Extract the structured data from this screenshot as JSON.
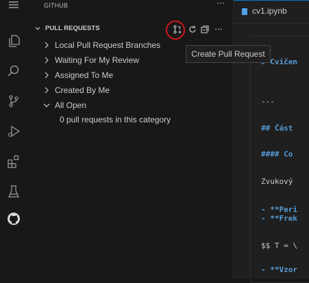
{
  "colors": {
    "accent": "#0078d4",
    "highlight_ring": "#d0161b",
    "md_heading": "#569cd6",
    "md_bold": "#569cd6"
  },
  "activity_bar": {
    "items": [
      {
        "icon": "menu-icon"
      },
      {
        "icon": "explorer-icon"
      },
      {
        "icon": "search-icon"
      },
      {
        "icon": "source-control-icon"
      },
      {
        "icon": "run-debug-icon"
      },
      {
        "icon": "extensions-icon"
      },
      {
        "icon": "testing-icon"
      },
      {
        "icon": "github-icon"
      }
    ]
  },
  "sidebar": {
    "title": "GITHUB",
    "more": "···",
    "pane": {
      "title": "PULL REQUESTS",
      "actions": [
        {
          "icon": "create-pull-request-icon"
        },
        {
          "icon": "refresh-icon"
        },
        {
          "icon": "collapse-all-icon"
        },
        {
          "icon": "more-icon",
          "label": "···"
        }
      ]
    },
    "tree": [
      {
        "label": "Local Pull Request Branches",
        "expanded": false
      },
      {
        "label": "Waiting For My Review",
        "expanded": false
      },
      {
        "label": "Assigned To Me",
        "expanded": false
      },
      {
        "label": "Created By Me",
        "expanded": false
      },
      {
        "label": "All Open",
        "expanded": true
      }
    ],
    "empty_message": "0 pull requests in this category"
  },
  "tooltip": {
    "text": "Create Pull Request"
  },
  "editor": {
    "tab_label": "cv1.ipynb",
    "lines": [
      {
        "text": "# Cvičen",
        "style": "heading"
      },
      {
        "text": "---",
        "style": "plain"
      },
      {
        "text": "## Část",
        "style": "heading"
      },
      {
        "text": "#### Co",
        "style": "heading"
      },
      {
        "text": "Zvukový",
        "style": "plain"
      },
      {
        "text": "- **Peri",
        "style": "bold"
      },
      {
        "text": "- **Frek",
        "style": "bold"
      },
      {
        "text": "$$ T = \\",
        "style": "plain"
      },
      {
        "text": "- **Vzor",
        "style": "bold"
      }
    ]
  }
}
